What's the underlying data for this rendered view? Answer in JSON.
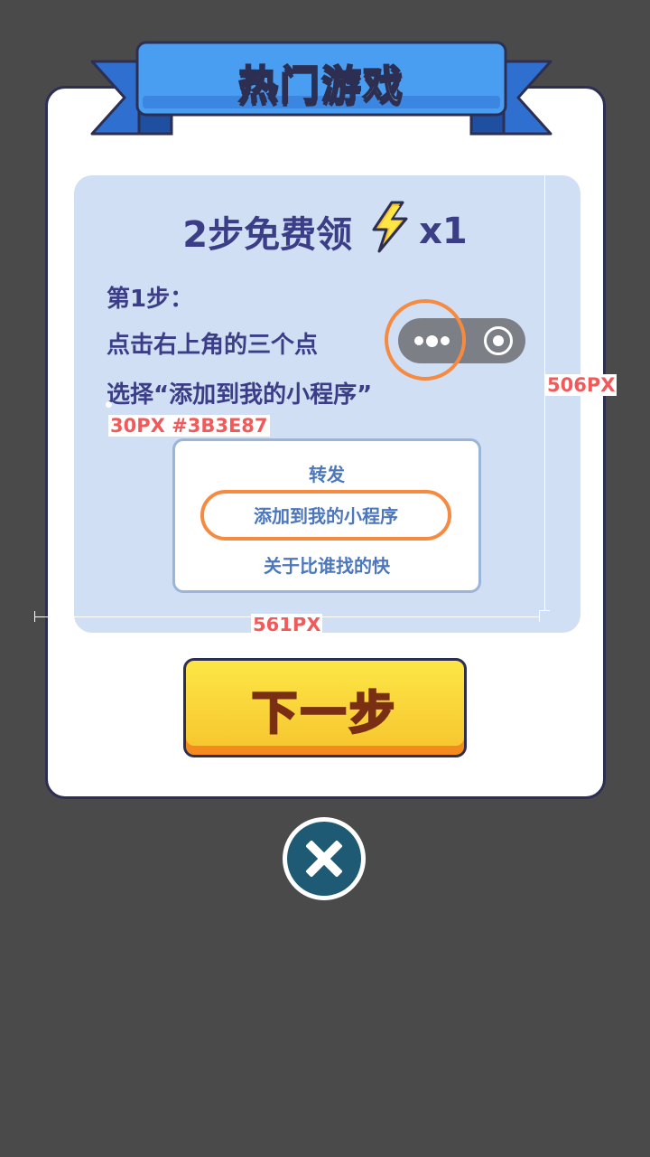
{
  "title": "热门游戏",
  "panel": {
    "heading": "2步免费领",
    "reward_icon": "lightning-icon",
    "reward_multiplier": "x1",
    "step_label": "第1步：",
    "instruction_1": "点击右上角的三个点",
    "instruction_2": "选择“添加到我的小程序”"
  },
  "menu": {
    "items": [
      "转发",
      "添加到我的小程序",
      "关于比谁找的快"
    ]
  },
  "annotations": {
    "font_note": "30PX #3B3E87",
    "height_note": "506PX",
    "width_note": "561PX"
  },
  "buttons": {
    "next_label": "下一步",
    "close_icon": "close-icon"
  },
  "colors": {
    "text_primary": "#3B3E87",
    "highlight": "#F58A40",
    "ribbon": "#4A9EF2",
    "button": "#FDE646",
    "annotation": "#F25A5A"
  }
}
